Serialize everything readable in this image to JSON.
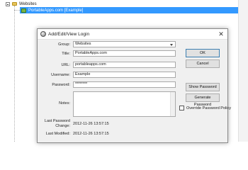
{
  "tree": {
    "group": "Websites",
    "entry": "PortableApps.com [Example]"
  },
  "dialog": {
    "title": "Add/Edit/View Login",
    "close": "✕",
    "fields": {
      "group_label": "Group:",
      "group_value": "Websites",
      "title_label": "Title:",
      "title_value": "PortableApps.com",
      "url_label": "URL:",
      "url_value": "portableapps.com",
      "username_label": "Username:",
      "username_value": "Example",
      "password_label": "Password:",
      "password_value": "********",
      "notes_label": "Notes:",
      "notes_value": ""
    },
    "buttons": {
      "ok": "OK",
      "cancel": "Cancel",
      "show_password": "Show Password",
      "generate_password": "Generate Password"
    },
    "override_policy_label": "Override Password Policy",
    "override_policy_checked": false,
    "last_password_change_label_1": "Last Password",
    "last_password_change_label_2": "Change:",
    "last_password_change_value": "2012-11-26 13:57:15",
    "last_modified_label": "Last Modified:",
    "last_modified_value": "2012-11-26 13:57:15"
  }
}
